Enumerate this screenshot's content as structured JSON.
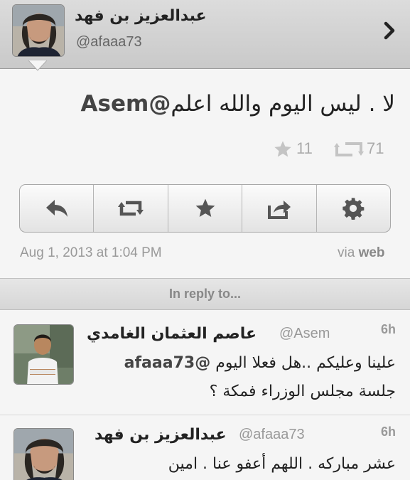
{
  "header": {
    "name": "عبدالعزيز بن فهد",
    "handle": "@afaaa73",
    "chevron_icon": "chevron-right-icon"
  },
  "tweet": {
    "text": "لا . ليس اليوم والله اعلم",
    "mention": "@Asem",
    "retweet_count": "71",
    "favorite_count": "11",
    "date": "Aug 1, 2013 at 1:04 PM",
    "via_prefix": "via",
    "via_source": "web"
  },
  "actions": [
    {
      "name": "reply",
      "icon": "reply-icon"
    },
    {
      "name": "retweet",
      "icon": "retweet-icon"
    },
    {
      "name": "favorite",
      "icon": "star-icon"
    },
    {
      "name": "share",
      "icon": "share-icon"
    },
    {
      "name": "settings",
      "icon": "gear-icon"
    }
  ],
  "reply_bar": {
    "label": "In reply to..."
  },
  "replies": [
    {
      "name": "عاصم العثمان الغامدي",
      "handle": "@Asem",
      "time": "6h",
      "mention": "@afaaa73",
      "text_line1": "علينا وعليكم ..هل فعلا اليوم",
      "text_line2": "جلسة مجلس الوزراء فمكة ؟"
    },
    {
      "name": "عبدالعزيز بن فهد",
      "handle": "@afaaa73",
      "time": "6h",
      "text_line1": "عشر مباركه . اللهم أعفو عنا . امين"
    }
  ],
  "colors": {
    "header_bg": "#d3d3d3",
    "page_bg": "#f5f5f5",
    "muted_text": "#999999",
    "icon_gray": "#555555"
  }
}
